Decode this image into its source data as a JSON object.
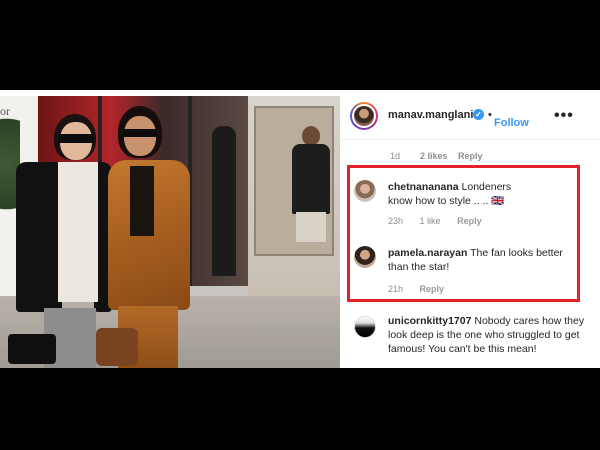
{
  "post": {
    "account": {
      "username": "manav.manglani",
      "verified_icon": "verified-badge-icon",
      "follow_separator": "•",
      "follow_label": "Follow",
      "more_label": "•••"
    },
    "photo": {
      "sign_text": "or"
    },
    "previous_comment_meta": {
      "age": "1d",
      "likes": "2 likes",
      "reply": "Reply"
    },
    "comments": [
      {
        "handle": "chetnananana",
        "text": "Londeners know how to style .. .. 🇬🇧",
        "age": "23h",
        "likes": "1 like",
        "reply": "Reply"
      },
      {
        "handle": "pamela.narayan",
        "text": "The fan looks better than the star!",
        "age": "21h",
        "likes": "",
        "reply": "Reply"
      },
      {
        "handle": "unicornkitty1707",
        "text": "Nobody cares how they look deep is the one who struggled to get famous! You can't be this mean!",
        "age": "",
        "likes": "",
        "reply": ""
      }
    ]
  },
  "colors": {
    "highlight": "#e0232a",
    "link_blue": "#3897f0",
    "verified_blue": "#3897f0"
  }
}
